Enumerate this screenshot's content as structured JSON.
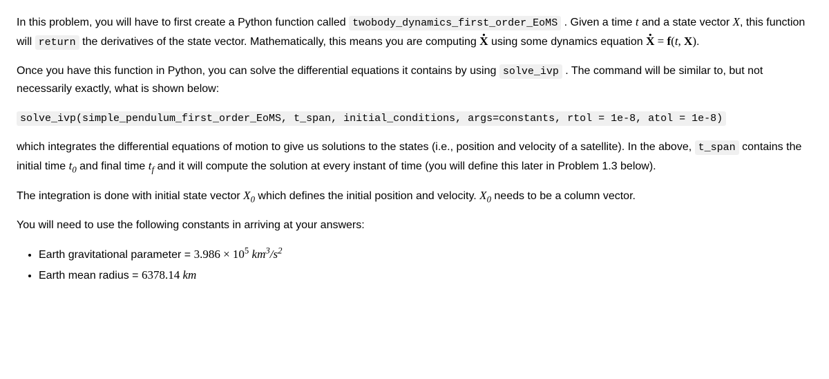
{
  "para1": {
    "t1": "In this problem, you will have to first create a Python function called ",
    "code1": "twobody_dynamics_first_order_EoMS",
    "t2": " . Given a time ",
    "var_t": "t",
    "t3": " and a state vector ",
    "var_X": "X",
    "t4": ", this function will ",
    "code2": "return",
    "t5": " the derivatives of the state vector. Mathematically, this means you are computing ",
    "var_Xdot": "X",
    "t6": " using some dynamics equation ",
    "eq_lhs": "X",
    "eq_eq": " = ",
    "eq_f": "f",
    "eq_open": "(",
    "eq_t": "t",
    "eq_comma": ", ",
    "eq_X": "X",
    "eq_close": ")",
    "t7": "."
  },
  "para2": {
    "t1": "Once you have this function in Python, you can solve the differential equations it contains by using ",
    "code1": "solve_ivp",
    "t2": " . The command will be similar to, but not necessarily exactly, what is shown below:"
  },
  "codeblock": "solve_ivp(simple_pendulum_first_order_EoMS, t_span, initial_conditions, args=constants, rtol = 1e-8, atol = 1e-8)",
  "para3": {
    "t1": "which integrates the differential equations of motion to give us solutions to the states (i.e., position and velocity of a satellite). In the above, ",
    "code1": "t_span",
    "t2": " contains the initial time ",
    "var_t0": "t",
    "sub0": "0",
    "t3": " and final time ",
    "var_tf": "t",
    "subf": "f",
    "t4": " and it will compute the solution at every instant of time (you will define this later in Problem 1.3 below)."
  },
  "para4": {
    "t1": "The integration is done with initial state vector ",
    "var_X0a": "X",
    "sub0a": "0",
    "t2": " which defines the initial position and velocity. ",
    "var_X0b": "X",
    "sub0b": "0",
    "t3": " needs to be a column vector."
  },
  "para5": "You will need to use the following constants in arriving at your answers:",
  "constants": {
    "mu": {
      "label": "Earth gravitational parameter = ",
      "coef": "3.986",
      "times": " × ",
      "base": "10",
      "exp": "5",
      "sp": " ",
      "unit_km": "km",
      "unit_exp1": "3",
      "slash": "/",
      "unit_s": "s",
      "unit_exp2": "2"
    },
    "radius": {
      "label": "Earth mean radius = ",
      "val": "6378.14",
      "sp": " ",
      "unit": "km"
    }
  }
}
